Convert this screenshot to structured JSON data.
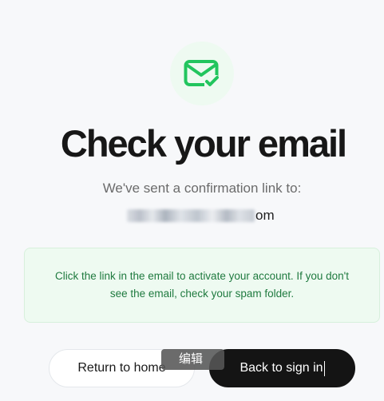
{
  "page": {
    "title": "Check your email",
    "subtitle": "We've sent a confirmation link to:",
    "email_suffix": "om"
  },
  "notice": {
    "text": "Click the link in the email to activate your account. If you don't see the email, check your spam folder."
  },
  "actions": {
    "return_home": "Return to home",
    "back_to_sign_in": "Back to sign in"
  },
  "overlay": {
    "edit_label": "编辑"
  },
  "icons": {
    "mail_check": "mail-check-icon"
  },
  "colors": {
    "success": "#22c55e",
    "notice_text": "#1f7a3f",
    "notice_bg": "#eefaf1",
    "primary_button": "#141414"
  }
}
